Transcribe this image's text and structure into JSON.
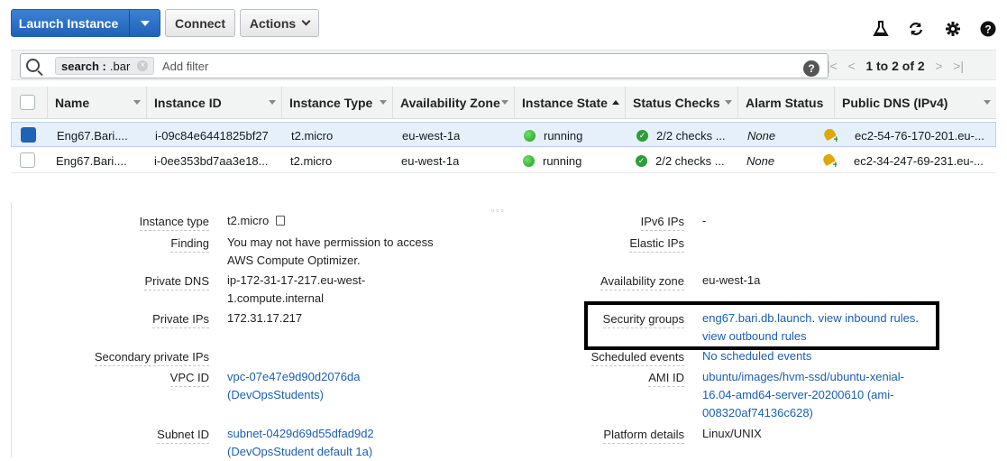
{
  "toolbar": {
    "launch_label": "Launch Instance",
    "connect_label": "Connect",
    "actions_label": "Actions",
    "icons": [
      "flask-icon",
      "refresh-icon",
      "gear-icon",
      "help-icon"
    ]
  },
  "filter": {
    "token_key": "search :",
    "token_value": ".bar",
    "placeholder": "Add filter",
    "pager_text": "1 to 2 of 2"
  },
  "table": {
    "columns": [
      "Name",
      "Instance ID",
      "Instance Type",
      "Availability Zone",
      "Instance State",
      "Status Checks",
      "Alarm Status",
      "Public DNS (IPv4)"
    ],
    "rows": [
      {
        "selected": true,
        "name": "Eng67.Bari....",
        "instance_id": "i-09c84e6441825bf27",
        "type": "t2.micro",
        "az": "eu-west-1a",
        "state": "running",
        "checks": "2/2 checks ...",
        "alarm": "None",
        "dns": "ec2-54-76-170-201.eu-..."
      },
      {
        "selected": false,
        "name": "Eng67.Bari....",
        "instance_id": "i-0ee353bd7aa3e18...",
        "type": "t2.micro",
        "az": "eu-west-1a",
        "state": "running",
        "checks": "2/2 checks ...",
        "alarm": "None",
        "dns": "ec2-34-247-69-231.eu-..."
      }
    ]
  },
  "details": {
    "instance_type_label": "Instance type",
    "instance_type_value": "t2.micro",
    "finding_label": "Finding",
    "finding_value_1": "You may not have permission to access",
    "finding_value_2": "AWS Compute Optimizer.",
    "private_dns_label": "Private DNS",
    "private_dns_value_1": "ip-172-31-17-217.eu-west-",
    "private_dns_value_2": "1.compute.internal",
    "private_ips_label": "Private IPs",
    "private_ips_value": "172.31.17.217",
    "secondary_ips_label": "Secondary private IPs",
    "vpc_label": "VPC ID",
    "vpc_value_1": "vpc-07e47e9d90d2076da",
    "vpc_value_2": "(DevOpsStudents)",
    "subnet_label": "Subnet ID",
    "subnet_value_1": "subnet-0429d69d55dfad9d2",
    "subnet_value_2": "(DevOpsStudent default 1a)",
    "ipv6_label": "IPv6 IPs",
    "ipv6_value": "-",
    "elastic_label": "Elastic IPs",
    "az_label": "Availability zone",
    "az_value": "eu-west-1a",
    "sg_label": "Security groups",
    "sg_link": "eng67.bari.db.launch",
    "sg_sep": ". ",
    "sg_inbound": "view inbound rules",
    "sg_sep2": ".",
    "sg_outbound": "view outbound rules",
    "sched_label": "Scheduled events",
    "sched_value": "No scheduled events",
    "ami_label": "AMI ID",
    "ami_value_1": "ubuntu/images/hvm-ssd/ubuntu-xenial-",
    "ami_value_2": "16.04-amd64-server-20200610 (ami-",
    "ami_value_3": "008320af74136c628)",
    "platform_label": "Platform details",
    "platform_value": "Linux/UNIX"
  }
}
